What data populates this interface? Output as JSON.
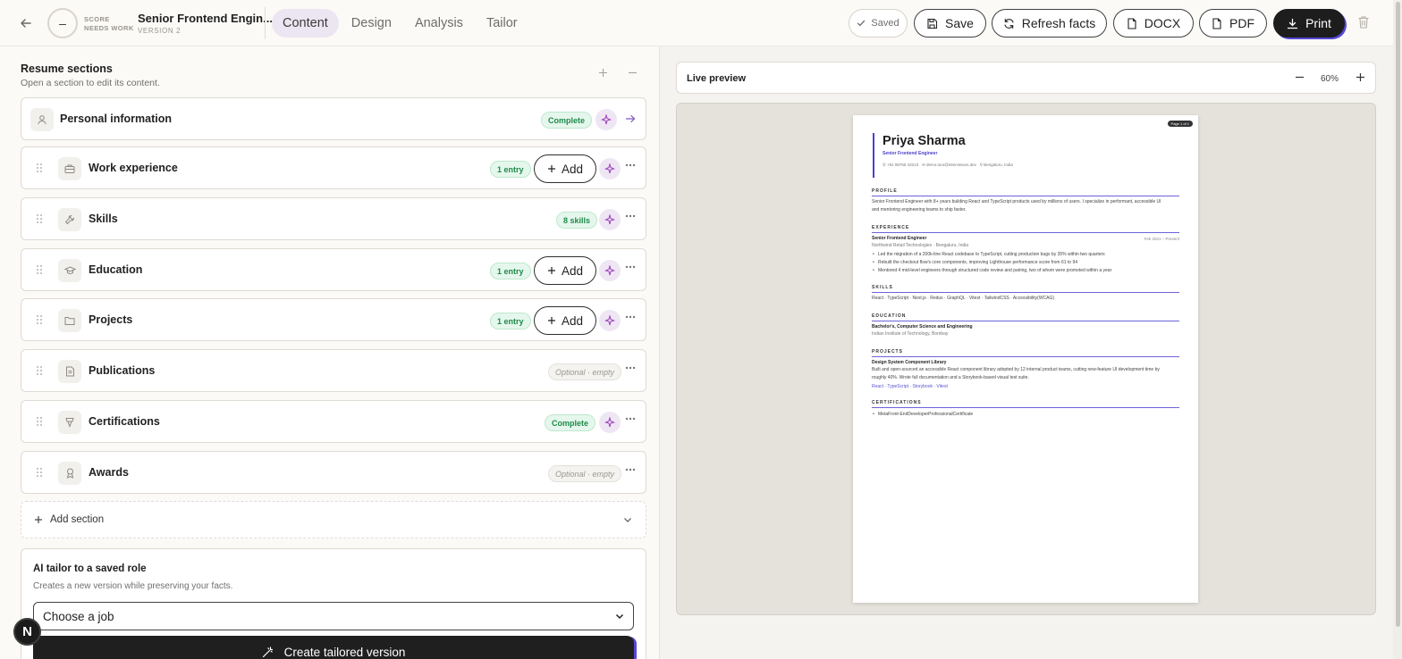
{
  "topbar": {
    "score_symbol": "–",
    "score_line1": "SCORE",
    "score_line2": "NEEDS WORK",
    "doc_title": "Senior Frontend Engin...",
    "doc_version": "VERSION 2",
    "tabs": [
      {
        "label": "Content",
        "active": true
      },
      {
        "label": "Design",
        "active": false
      },
      {
        "label": "Analysis",
        "active": false
      },
      {
        "label": "Tailor",
        "active": false
      }
    ],
    "saved_label": "Saved",
    "save_label": "Save",
    "refresh_label": "Refresh facts",
    "docx_label": "DOCX",
    "pdf_label": "PDF",
    "print_label": "Print"
  },
  "sections_panel": {
    "title": "Resume sections",
    "subtitle": "Open a section to edit its content.",
    "cards": [
      {
        "title": "Personal information",
        "badge": "Complete",
        "badge_type": "green"
      },
      {
        "title": "Work experience",
        "badge": "1 entry",
        "badge_type": "green",
        "add_label": "Add"
      },
      {
        "title": "Skills",
        "badge": "8 skills",
        "badge_type": "green"
      },
      {
        "title": "Education",
        "badge": "1 entry",
        "badge_type": "green",
        "add_label": "Add"
      },
      {
        "title": "Projects",
        "badge": "1 entry",
        "badge_type": "green",
        "add_label": "Add"
      },
      {
        "title": "Publications",
        "badge": "Optional · empty",
        "badge_type": "optional"
      },
      {
        "title": "Certifications",
        "badge": "Complete",
        "badge_type": "green"
      },
      {
        "title": "Awards",
        "badge": "Optional · empty",
        "badge_type": "optional"
      }
    ],
    "add_section_label": "Add section"
  },
  "tailor": {
    "title": "AI tailor to a saved role",
    "subtitle": "Creates a new version while preserving your facts.",
    "select_value": "Choose a job",
    "create_label": "Create tailored version"
  },
  "assistant_badge": "N",
  "preview": {
    "title": "Live preview",
    "zoom": "60%",
    "page_tag": "Page 1 of 1",
    "resume": {
      "name": "Priya Sharma",
      "role": "Senior Frontend Engineer",
      "contact_phone": "+91 98765 43210",
      "contact_email": "demo.tour@interviewos.dev",
      "contact_location": "Bengaluru, India",
      "profile_heading": "PROFILE",
      "profile_text": "Senior Frontend Engineer with 8+ years building React and TypeScript products used by millions of users. I specialize in performant, accessible UI and mentoring engineering teams to ship faster.",
      "experience_heading": "EXPERIENCE",
      "job_title": "Senior Frontend Engineer",
      "job_company": "Northwind Retail Technologies · Bengaluru, India",
      "job_dates": "Feb 2021 – Present",
      "job_bullets": [
        "Led the migration of a 200k-line React codebase to TypeScript, cutting production bugs by 35% within two quarters",
        "Rebuilt the checkout flow's core components, improving Lighthouse performance score from 61 to 94",
        "Mentored 4 mid-level engineers through structured code review and pairing, two of whom were promoted within a year"
      ],
      "skills_heading": "SKILLS",
      "skills_text": "React · TypeScript · Next.js · Redux · GraphQL · Vitest · TailwindCSS · Accessibility(WCAG)",
      "education_heading": "EDUCATION",
      "degree": "Bachelor's, Computer Science and Engineering",
      "school": "Indian Institute of Technology, Bombay",
      "projects_heading": "PROJECTS",
      "project_title": "Design System Component Library",
      "project_text": "Built and open-sourced an accessible React component library adopted by 12 internal product teams, cutting new-feature UI development time by roughly 40%. Wrote full documentation and a Storybook-based visual test suite.",
      "project_tech": "React · TypeScript · Storybook · Vitest",
      "certifications_heading": "CERTIFICATIONS",
      "certification": "MetaFront-EndDeveloperProfessionalCertificate"
    }
  },
  "colors": {
    "accent": "#5548d6",
    "brand_dark": "#1d1d1d",
    "complete_green": "#1f8a4a",
    "ai_purple": "#9b3fb8"
  }
}
